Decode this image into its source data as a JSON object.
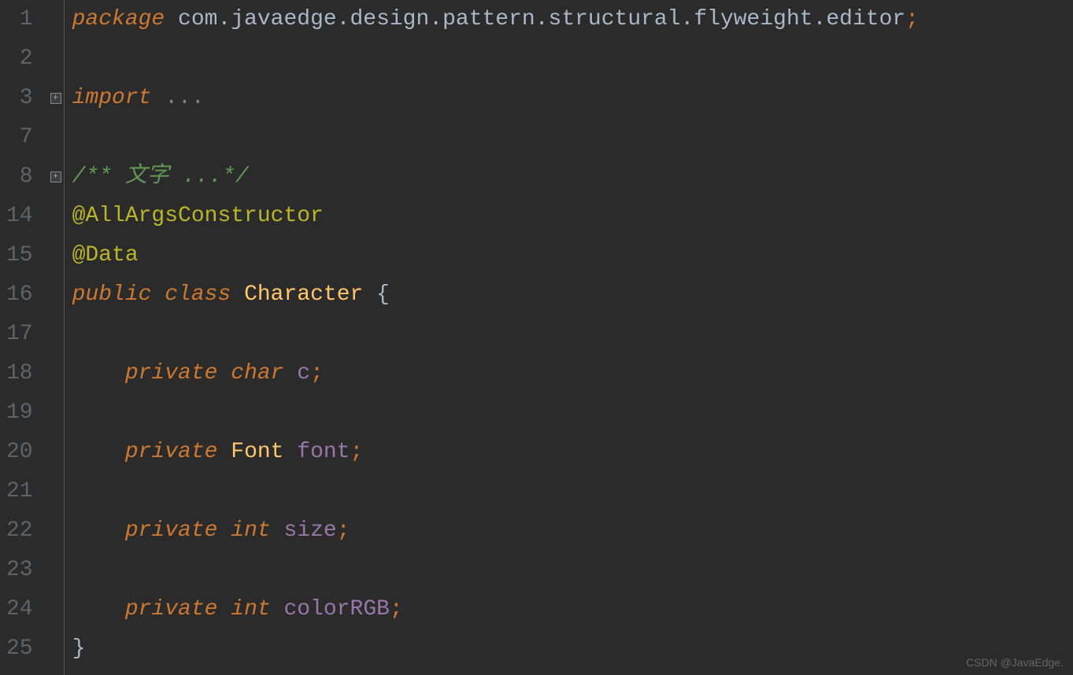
{
  "gutter": {
    "lines": [
      "1",
      "2",
      "3",
      "7",
      "8",
      "14",
      "15",
      "16",
      "17",
      "18",
      "19",
      "20",
      "21",
      "22",
      "23",
      "24",
      "25"
    ]
  },
  "code": {
    "line1": {
      "kw": "package",
      "pkg": " com.javaedge.design.pattern.structural.flyweight.editor",
      "semi": ";"
    },
    "line3": {
      "kw": "import",
      "ellipsis": " ..."
    },
    "line8": {
      "comment": "/** 文字 ...*/"
    },
    "line14": {
      "annotation": "@AllArgsConstructor"
    },
    "line15": {
      "annotation": "@Data"
    },
    "line16": {
      "kw1": "public",
      "kw2": "class",
      "name": "Character",
      "brace": "{"
    },
    "line18": {
      "kw": "private",
      "type": "char",
      "id": "c",
      "semi": ";"
    },
    "line20": {
      "kw": "private",
      "type": "Font",
      "id": "font",
      "semi": ";"
    },
    "line22": {
      "kw": "private",
      "type": "int",
      "id": "size",
      "semi": ";"
    },
    "line24": {
      "kw": "private",
      "type": "int",
      "id": "colorRGB",
      "semi": ";"
    },
    "line25": {
      "brace": "}"
    }
  },
  "fold": {
    "plus": "+",
    "minus": "−"
  },
  "watermark": "CSDN @JavaEdge."
}
